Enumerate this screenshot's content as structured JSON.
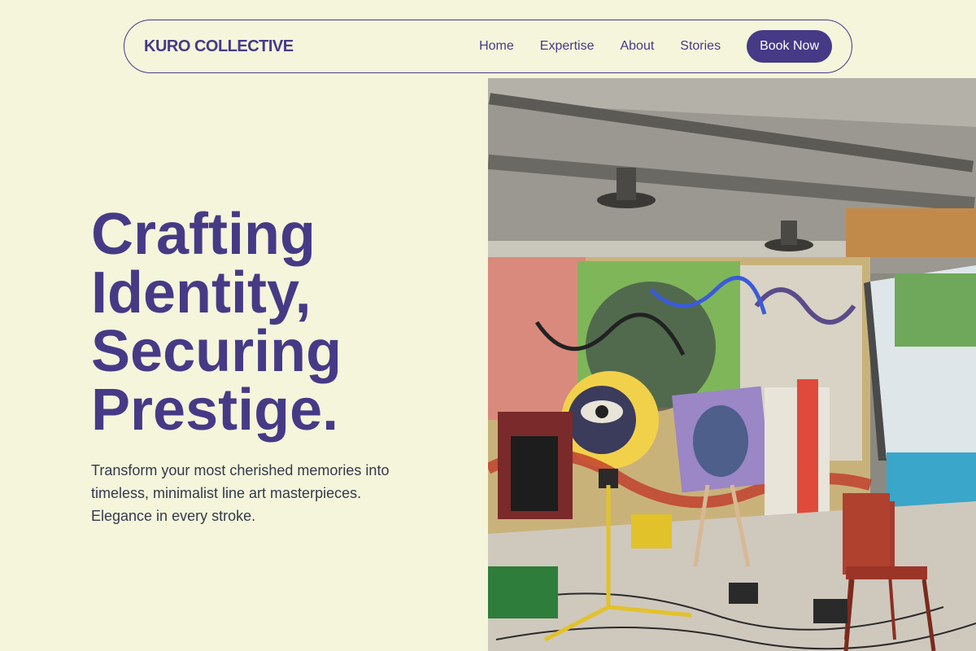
{
  "brand": "KURO COLLECTIVE",
  "nav": {
    "links": [
      "Home",
      "Expertise",
      "About",
      "Stories"
    ],
    "cta": "Book Now"
  },
  "hero": {
    "title_lines": [
      "Crafting",
      "Identity,",
      "Securing",
      "Prestige."
    ],
    "subtitle": "Transform your most cherished memories into timeless, minimalist line art masterpieces. Elegance in every stroke."
  },
  "image": {
    "description_icon": "art-studio-photo"
  },
  "colors": {
    "background": "#f5f5dc",
    "accent": "#463a86",
    "body_text": "#333a4a"
  }
}
